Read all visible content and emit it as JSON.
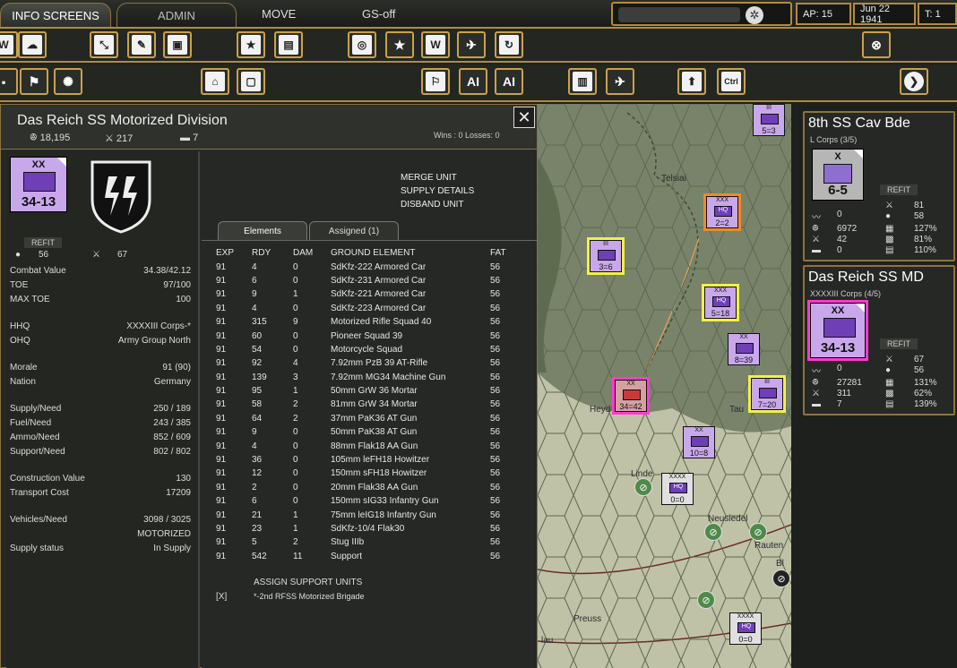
{
  "topbar": {
    "tabs": [
      "INFO SCREENS",
      "ADMIN"
    ],
    "menu": [
      "MOVE",
      "GS-off"
    ],
    "ap": "AP: 15",
    "date": "Jun 22 1941",
    "turn": "T: 1"
  },
  "unit": {
    "title": "Das Reich SS Motorized Division",
    "men": "18,195",
    "guns": "217",
    "tanks": "7",
    "winloss": "Wins : 0  Losses: 0",
    "counter": {
      "size": "XX",
      "strength": "34-13"
    },
    "refit": "REFIT",
    "supply_drops": "56",
    "kills": "67",
    "stats": [
      {
        "label": "Combat Value",
        "value": "34.38/42.12"
      },
      {
        "label": "TOE",
        "value": "97/100"
      },
      {
        "label": "MAX TOE",
        "value": "100"
      },
      {
        "label": "HHQ",
        "value": "XXXXIII Corps-*"
      },
      {
        "label": "OHQ",
        "value": "Army Group North"
      },
      {
        "label": "Morale",
        "value": "91 (90)"
      },
      {
        "label": "Nation",
        "value": "Germany"
      },
      {
        "label": "Supply/Need",
        "value": "250 / 189"
      },
      {
        "label": "Fuel/Need",
        "value": "243 / 385"
      },
      {
        "label": "Ammo/Need",
        "value": "852 / 609"
      },
      {
        "label": "Support/Need",
        "value": "802 / 802"
      },
      {
        "label": "Construction Value",
        "value": "130"
      },
      {
        "label": "Transport Cost",
        "value": "17209"
      },
      {
        "label": "Vehicles/Need",
        "value": "3098 / 3025"
      },
      {
        "label": "",
        "value": "MOTORIZED"
      },
      {
        "label": "Supply status",
        "value": "In Supply"
      }
    ],
    "actions": [
      "MERGE UNIT",
      "SUPPLY DETAILS",
      "DISBAND UNIT"
    ],
    "element_tabs": [
      "Elements",
      "Assigned (1)"
    ],
    "columns": [
      "EXP",
      "RDY",
      "DAM",
      "GROUND ELEMENT",
      "FAT"
    ],
    "elements": [
      [
        "91",
        "4",
        "0",
        "SdKfz-222 Armored Car",
        "56"
      ],
      [
        "91",
        "6",
        "0",
        "SdKfz-231 Armored Car",
        "56"
      ],
      [
        "91",
        "9",
        "1",
        "SdKfz-221 Armored Car",
        "56"
      ],
      [
        "91",
        "4",
        "0",
        "SdKfz-223 Armored Car",
        "56"
      ],
      [
        "91",
        "315",
        "9",
        "Motorized Rifle Squad 40",
        "56"
      ],
      [
        "91",
        "60",
        "0",
        "Pioneer Squad 39",
        "56"
      ],
      [
        "91",
        "54",
        "0",
        "Motorcycle Squad",
        "56"
      ],
      [
        "91",
        "92",
        "4",
        "7.92mm PzB 39 AT-Rifle",
        "56"
      ],
      [
        "91",
        "139",
        "3",
        "7.92mm MG34 Machine Gun",
        "56"
      ],
      [
        "91",
        "95",
        "1",
        "50mm GrW 36 Mortar",
        "56"
      ],
      [
        "91",
        "58",
        "2",
        "81mm GrW 34 Mortar",
        "56"
      ],
      [
        "91",
        "64",
        "2",
        "37mm PaK36 AT Gun",
        "56"
      ],
      [
        "91",
        "9",
        "0",
        "50mm PaK38 AT Gun",
        "56"
      ],
      [
        "91",
        "4",
        "0",
        "88mm Flak18 AA Gun",
        "56"
      ],
      [
        "91",
        "36",
        "0",
        "105mm leFH18 Howitzer",
        "56"
      ],
      [
        "91",
        "12",
        "0",
        "150mm sFH18 Howitzer",
        "56"
      ],
      [
        "91",
        "2",
        "0",
        "20mm Flak38 AA Gun",
        "56"
      ],
      [
        "91",
        "6",
        "0",
        "150mm sIG33 Infantry Gun",
        "56"
      ],
      [
        "91",
        "21",
        "1",
        "75mm leIG18 Infantry Gun",
        "56"
      ],
      [
        "91",
        "23",
        "1",
        "SdKfz-10/4 Flak30",
        "56"
      ],
      [
        "91",
        "5",
        "2",
        "Stug IIIb",
        "56"
      ],
      [
        "91",
        "542",
        "11",
        "Support",
        "56"
      ]
    ],
    "assign_support": "ASSIGN SUPPORT UNITS",
    "assigned_mark": "[X]",
    "assigned_unit": "*-2nd RFSS Motorized Brigade"
  },
  "map": {
    "labels": [
      "Telsiai",
      "Heyd",
      "Tau",
      "Linde",
      "Neusiedel",
      "Rauten",
      "Preuss",
      "lau",
      "Bl"
    ],
    "counters": [
      {
        "top": "III",
        "box": "",
        "str": "5=3"
      },
      {
        "top": "XXX",
        "box": "HQ",
        "str": "2=2"
      },
      {
        "top": "III",
        "box": "",
        "str": "3=6"
      },
      {
        "top": "XXX",
        "box": "HQ",
        "str": "5=18"
      },
      {
        "top": "XX",
        "box": "",
        "str": "8=39"
      },
      {
        "top": "XX",
        "box": "",
        "str": "34=42"
      },
      {
        "top": "III",
        "box": "",
        "str": "7=20"
      },
      {
        "top": "XX",
        "box": "",
        "str": "10=8"
      },
      {
        "top": "XXXX",
        "box": "HQ",
        "str": "0=0"
      },
      {
        "top": "XXXX",
        "box": "HQ",
        "str": "0=0"
      }
    ]
  },
  "cav": {
    "title": "8th SS Cav Bde",
    "sub": "L Corps (3/5)",
    "counter": {
      "size": "X",
      "strength": "6-5"
    },
    "refit": "REFIT",
    "vals": [
      "0",
      "81",
      "0",
      "58",
      "6972",
      "127%",
      "42",
      "81%",
      "0",
      "110%"
    ]
  },
  "dr": {
    "title": "Das Reich SS MD",
    "sub": "XXXXIII Corps (4/5)",
    "counter": {
      "size": "XX",
      "strength": "34-13"
    },
    "refit": "REFIT",
    "vals": [
      "0",
      "67",
      "0",
      "56",
      "27281",
      "131%",
      "311",
      "62%",
      "7",
      "139%"
    ]
  },
  "icons": [
    "settings-icon",
    "globe-icon",
    "close-icon",
    "next-icon",
    "ctrl-icon",
    "up-icon"
  ]
}
